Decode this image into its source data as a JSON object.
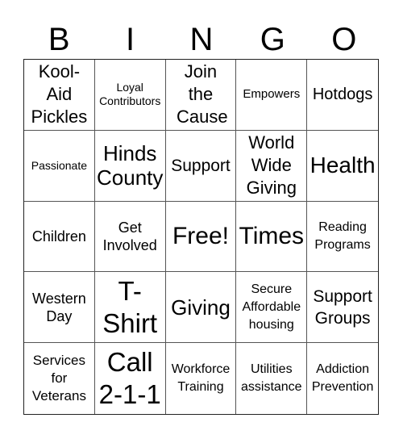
{
  "header": {
    "letters": [
      "B",
      "I",
      "N",
      "G",
      "O"
    ]
  },
  "board": {
    "rows": [
      [
        "Kool-Aid Pickles",
        "Loyal Contributors",
        "Join the Cause",
        "Empowers",
        "Hotdogs"
      ],
      [
        "Passionate",
        "Hinds County",
        "Support",
        "World Wide Giving",
        "Health"
      ],
      [
        "Children",
        "Get Involved",
        "Free!",
        "Times",
        "Reading Programs"
      ],
      [
        "Western Day",
        "T-Shirt",
        "Giving",
        "Secure Affordable housing",
        "Support Groups"
      ],
      [
        "Services for Veterans",
        "Call 2-1-1",
        "Workforce Training",
        "Utilities assistance",
        "Addiction Prevention"
      ]
    ]
  }
}
